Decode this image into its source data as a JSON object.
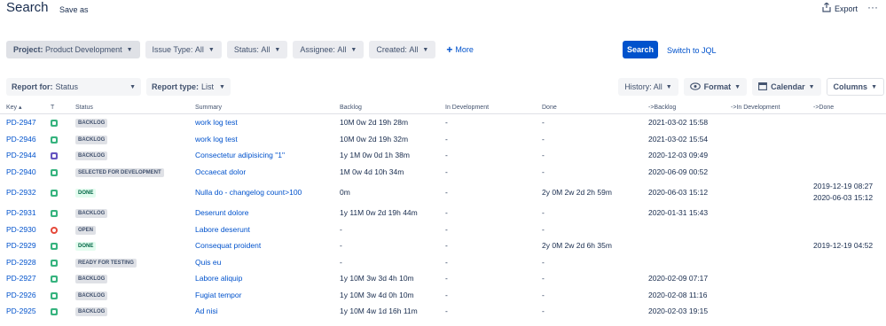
{
  "header": {
    "title": "Search",
    "save_as": "Save as",
    "export": "Export",
    "more": "···"
  },
  "filters": [
    {
      "label": "Project:",
      "value": "Product Development"
    },
    {
      "label": "Issue Type:",
      "value": "All"
    },
    {
      "label": "Status:",
      "value": "All"
    },
    {
      "label": "Assignee:",
      "value": "All"
    },
    {
      "label": "Created:",
      "value": "All"
    }
  ],
  "more_filters": "More",
  "search_button": "Search",
  "switch_jql": "Switch to JQL",
  "report": {
    "report_for_label": "Report for:",
    "report_for_value": "Status",
    "report_type_label": "Report type:",
    "report_type_value": "List"
  },
  "controls": {
    "history": "History: All",
    "format": "Format",
    "calendar": "Calendar",
    "columns": "Columns"
  },
  "table": {
    "headers": [
      "Key",
      "T",
      "Status",
      "Summary",
      "Backlog",
      "In Development",
      "Done",
      "->Backlog",
      "->In Development",
      "->Done"
    ],
    "rows": [
      {
        "key": "PD-2947",
        "type": "story",
        "status": "BACKLOG",
        "status_kind": "default",
        "summary": "work log test",
        "backlog": "10M 0w 2d 19h 28m",
        "in_dev": "-",
        "done": "-",
        "to_backlog": "2021-03-02 15:58",
        "to_in_dev": "",
        "to_done": ""
      },
      {
        "key": "PD-2946",
        "type": "story",
        "status": "BACKLOG",
        "status_kind": "default",
        "summary": "work log test",
        "backlog": "10M 0w 2d 19h 32m",
        "in_dev": "-",
        "done": "-",
        "to_backlog": "2021-03-02 15:54",
        "to_in_dev": "",
        "to_done": ""
      },
      {
        "key": "PD-2944",
        "type": "epic",
        "status": "BACKLOG",
        "status_kind": "default",
        "summary": "Consectetur adipisicing \"1\"",
        "backlog": "1y 1M 0w 0d 1h 38m",
        "in_dev": "-",
        "done": "-",
        "to_backlog": "2020-12-03 09:49",
        "to_in_dev": "",
        "to_done": ""
      },
      {
        "key": "PD-2940",
        "type": "story",
        "status": "SELECTED FOR DEVELOPMENT",
        "status_kind": "default",
        "summary": "Occaecat dolor",
        "backlog": "1M 0w 4d 10h 34m",
        "in_dev": "-",
        "done": "-",
        "to_backlog": "2020-06-09 00:52",
        "to_in_dev": "",
        "to_done": ""
      },
      {
        "key": "PD-2932",
        "type": "story",
        "status": "DONE",
        "status_kind": "done",
        "summary": "Nulla do - changelog count>100",
        "backlog": "0m",
        "in_dev": "-",
        "done": "2y 0M 2w 2d 2h 59m",
        "to_backlog": "2020-06-03 15:12",
        "to_in_dev": "",
        "to_done": "2019-12-19 08:27",
        "to_done_2": "2020-06-03 15:12"
      },
      {
        "key": "PD-2931",
        "type": "story",
        "status": "BACKLOG",
        "status_kind": "default",
        "summary": "Deserunt dolore",
        "backlog": "1y 11M 0w 2d 19h 44m",
        "in_dev": "-",
        "done": "-",
        "to_backlog": "2020-01-31 15:43",
        "to_in_dev": "",
        "to_done": ""
      },
      {
        "key": "PD-2930",
        "type": "bug",
        "status": "OPEN",
        "status_kind": "open",
        "summary": "Labore deserunt",
        "backlog": "-",
        "in_dev": "-",
        "done": "-",
        "to_backlog": "",
        "to_in_dev": "",
        "to_done": ""
      },
      {
        "key": "PD-2929",
        "type": "story",
        "status": "DONE",
        "status_kind": "done",
        "summary": "Consequat proident",
        "backlog": "-",
        "in_dev": "-",
        "done": "2y 0M 2w 2d 6h 35m",
        "to_backlog": "",
        "to_in_dev": "",
        "to_done": "2019-12-19 04:52"
      },
      {
        "key": "PD-2928",
        "type": "story",
        "status": "READY FOR TESTING",
        "status_kind": "default",
        "summary": "Quis eu",
        "backlog": "-",
        "in_dev": "-",
        "done": "-",
        "to_backlog": "",
        "to_in_dev": "",
        "to_done": ""
      },
      {
        "key": "PD-2927",
        "type": "story",
        "status": "BACKLOG",
        "status_kind": "default",
        "summary": "Labore aliquip",
        "backlog": "1y 10M 3w 3d 4h 10m",
        "in_dev": "-",
        "done": "-",
        "to_backlog": "2020-02-09 07:17",
        "to_in_dev": "",
        "to_done": ""
      },
      {
        "key": "PD-2926",
        "type": "story",
        "status": "BACKLOG",
        "status_kind": "default",
        "summary": "Fugiat tempor",
        "backlog": "1y 10M 3w 4d 0h 10m",
        "in_dev": "-",
        "done": "-",
        "to_backlog": "2020-02-08 11:16",
        "to_in_dev": "",
        "to_done": ""
      },
      {
        "key": "PD-2925",
        "type": "story",
        "status": "BACKLOG",
        "status_kind": "default",
        "summary": "Ad nisi",
        "backlog": "1y 10M 4w 1d 16h 11m",
        "in_dev": "-",
        "done": "-",
        "to_backlog": "2020-02-03 19:15",
        "to_in_dev": "",
        "to_done": ""
      }
    ]
  },
  "colors": {
    "accent": "#0052cc",
    "story": "#36b37e",
    "epic": "#6554c0",
    "bug": "#e5493a"
  }
}
